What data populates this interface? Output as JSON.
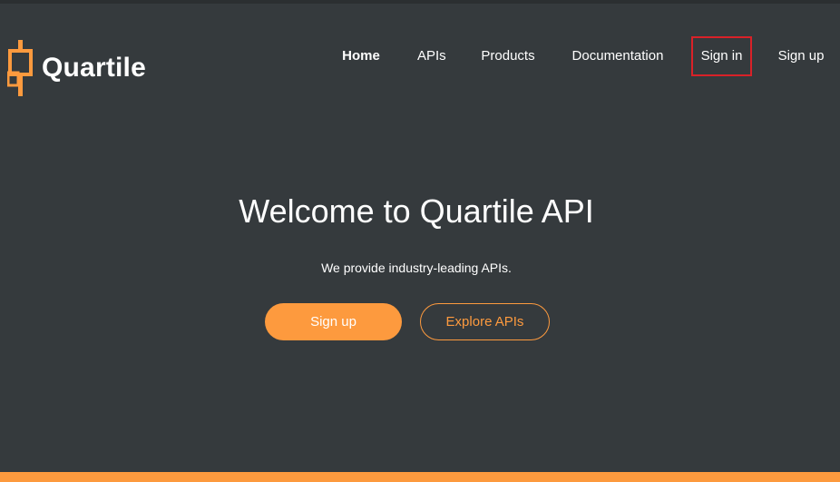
{
  "brand": {
    "name": "Quartile",
    "logo_icon": "candlestick-icon",
    "accent_color": "#fd9a3e",
    "background_color": "#353a3d",
    "highlight_color": "#d92128"
  },
  "nav": {
    "items": [
      {
        "label": "Home"
      },
      {
        "label": "APIs"
      },
      {
        "label": "Products"
      },
      {
        "label": "Documentation"
      },
      {
        "label": "Sign in"
      },
      {
        "label": "Sign up"
      }
    ]
  },
  "hero": {
    "title": "Welcome to Quartile API",
    "subtitle": "We provide industry-leading APIs.",
    "primary_button": "Sign up",
    "secondary_button": "Explore APIs"
  }
}
